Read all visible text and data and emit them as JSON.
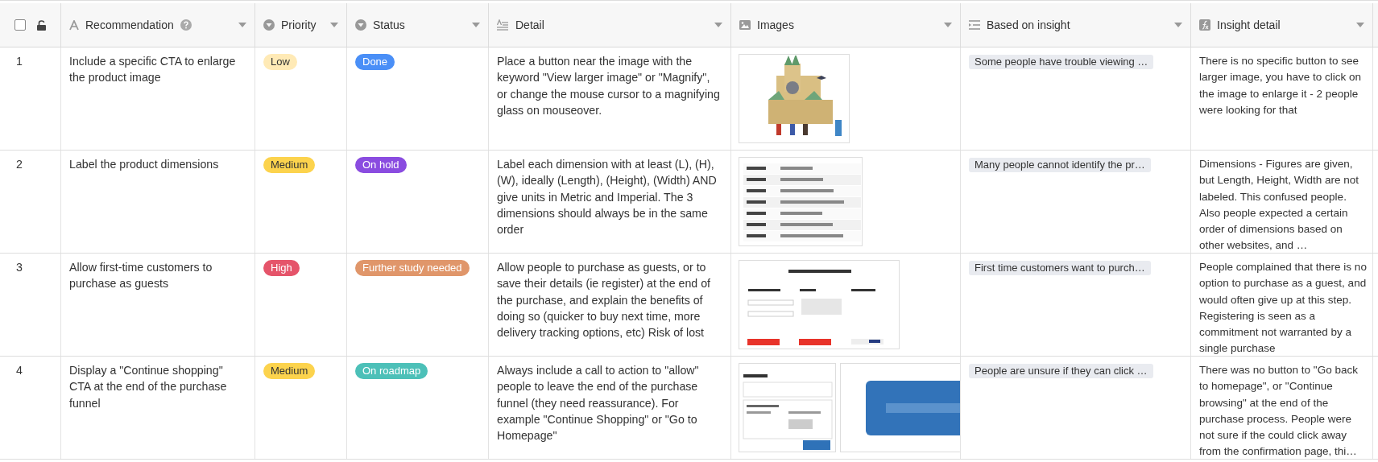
{
  "header": {
    "select_all": {
      "checked": false
    },
    "locked": false,
    "columns": [
      {
        "label": "Recommendation",
        "kind": "text",
        "help": true
      },
      {
        "label": "Priority",
        "kind": "select",
        "help": false
      },
      {
        "label": "Status",
        "kind": "select",
        "help": false
      },
      {
        "label": "Detail",
        "kind": "longtext",
        "help": false
      },
      {
        "label": "Images",
        "kind": "attachment",
        "help": false
      },
      {
        "label": "Based on insight",
        "kind": "link",
        "help": false
      },
      {
        "label": "Insight detail",
        "kind": "formula",
        "help": false
      }
    ]
  },
  "rows": [
    {
      "number": "1",
      "recommendation": "Include a specific CTA to enlarge the product image",
      "priority": {
        "label": "Low",
        "color": "#ffeab6"
      },
      "status": {
        "label": "Done",
        "color": "#4a8ff7"
      },
      "detail": "Place a button near the image with the keyword \"View larger image\" or \"Magnify\", or change the mouse cursor to a magnifying glass on mouseover.",
      "insight": "Some people have trouble viewing …",
      "insight_detail": "There is no specific button to see larger image, you have to click on the image to enlarge it - 2 people were looking for that"
    },
    {
      "number": "2",
      "recommendation": "Label the product dimensions",
      "priority": {
        "label": "Medium",
        "color": "#fcd34d"
      },
      "status": {
        "label": "On hold",
        "color": "#8a4ce0"
      },
      "detail": "Label each dimension with at least (L), (H), (W), ideally (Length), (Height), (Width) AND give units in Metric and Imperial. The 3 dimensions should always be in the same order",
      "insight": "Many people cannot identify the pr…",
      "insight_detail": "Dimensions - Figures are given, but Length, Height, Width are not labeled. This confused people. Also people expected a certain order of dimensions based on other websites, and …"
    },
    {
      "number": "3",
      "recommendation": "Allow first-time customers to purchase as guests",
      "priority": {
        "label": "High",
        "color": "#e5546a"
      },
      "status": {
        "label": "Further study needed",
        "color": "#e0966a"
      },
      "detail": "Allow people to purchase as guests, or to save their details (ie register) at the end of the purchase, and explain the benefits of doing so (quicker to buy next time, more delivery tracking options, etc) Risk of lost",
      "insight": "First time customers want to purch…",
      "insight_detail": "People complained that there is no option to purchase as a guest, and would often give up at this step. Registering is seen as a commitment not warranted by a single purchase"
    },
    {
      "number": "4",
      "recommendation": "Display a \"Continue shopping\" CTA at the end of the purchase funnel",
      "priority": {
        "label": "Medium",
        "color": "#fcd34d"
      },
      "status": {
        "label": "On roadmap",
        "color": "#4cc0b8"
      },
      "detail": "Always include a call to action to \"allow\" people to leave the end of the purchase funnel (they need reassurance). For example \"Continue Shopping\" or \"Go to Homepage\"",
      "insight": "People are unsure if they can click …",
      "insight_detail": "There was no button to \"Go back to homepage\", or \"Continue browsing\" at the end of the purchase process. People were not sure if the could click away from the confirmation page, thi…"
    }
  ]
}
